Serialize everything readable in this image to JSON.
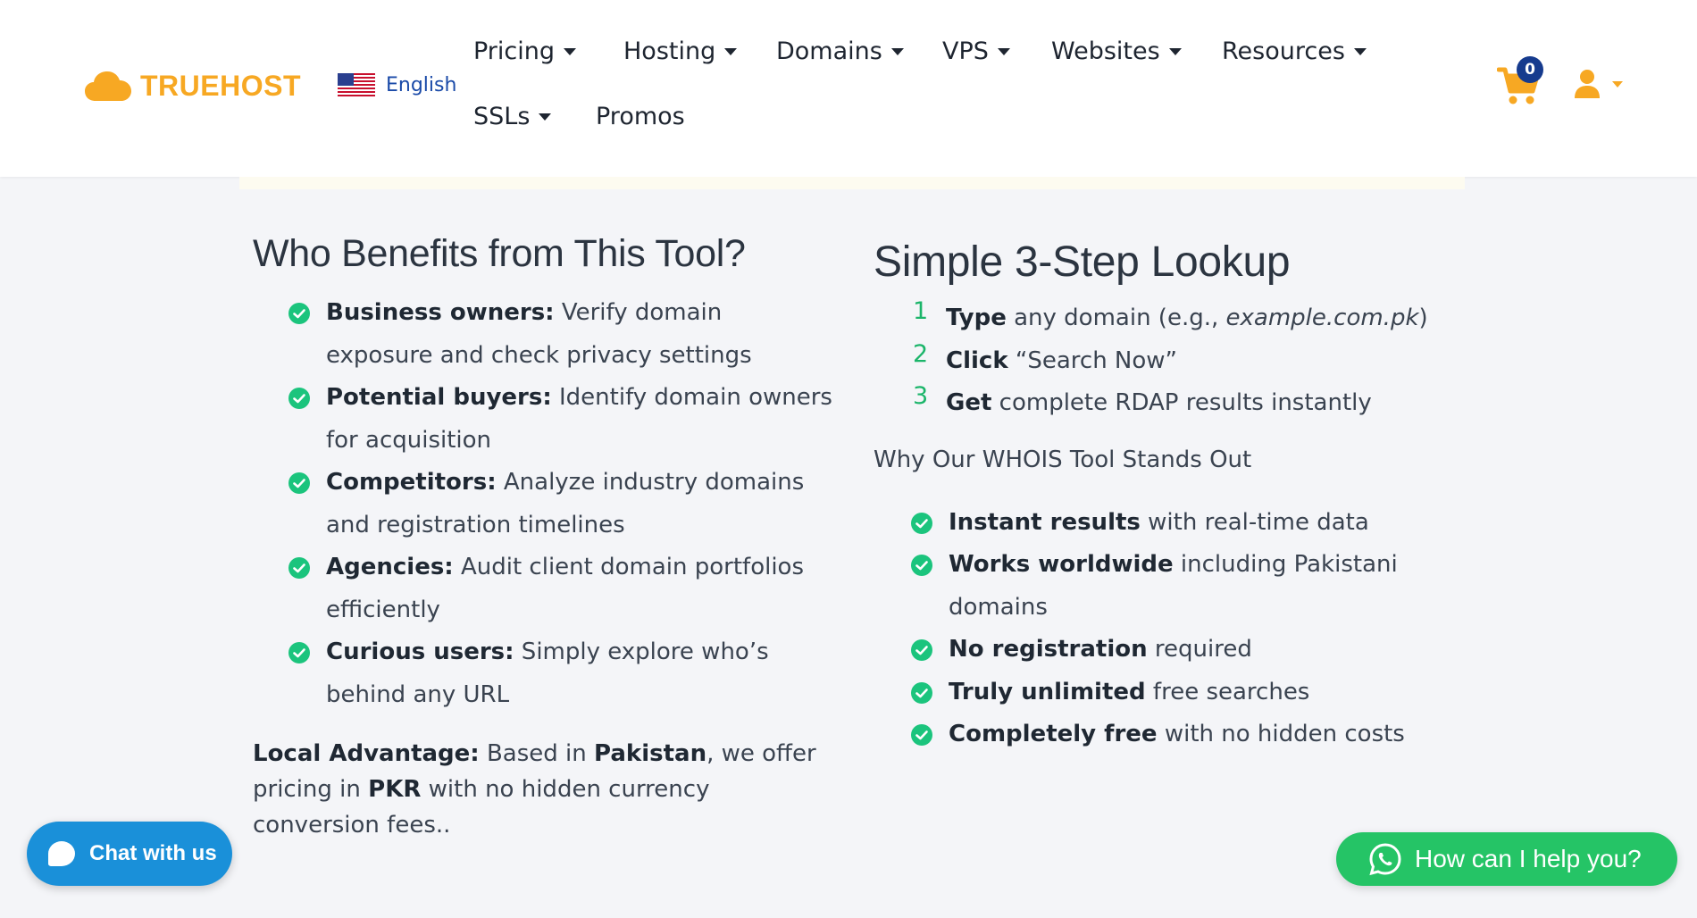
{
  "header": {
    "logo_text": "TRUEHOST",
    "language": "English",
    "nav": [
      {
        "label": "Pricing",
        "has_dropdown": true
      },
      {
        "label": "Hosting",
        "has_dropdown": true
      },
      {
        "label": "Domains",
        "has_dropdown": true
      },
      {
        "label": "VPS",
        "has_dropdown": true
      },
      {
        "label": "Websites",
        "has_dropdown": true
      },
      {
        "label": "Resources",
        "has_dropdown": true
      },
      {
        "label": "SSLs",
        "has_dropdown": true
      },
      {
        "label": "Promos",
        "has_dropdown": false
      }
    ],
    "cart_count": "0",
    "icons": {
      "cart": "cart-icon",
      "user": "user-icon",
      "logo": "cloud-logo-icon",
      "flag": "us-flag-icon"
    }
  },
  "left": {
    "title": "Who Benefits from This Tool?",
    "items": [
      {
        "bold": "Business owners:",
        "text": " Verify domain exposure and check privacy settings"
      },
      {
        "bold": "Potential buyers:",
        "text": " Identify domain owners for acquisition"
      },
      {
        "bold": "Competitors:",
        "text": " Analyze industry domains and registration timelines"
      },
      {
        "bold": "Agencies:",
        "text": " Audit client domain portfolios efficiently"
      },
      {
        "bold": "Curious users:",
        "text": " Simply explore who’s behind any URL"
      }
    ],
    "advantage": {
      "label": "Local Advantage:",
      "text1": " Based in ",
      "country": "Pakistan",
      "text2": ", we offer pricing in ",
      "currency": "PKR",
      "text3": " with no hidden currency conversion fees.."
    }
  },
  "right": {
    "title": "Simple 3-Step Lookup",
    "steps": [
      {
        "num": "1",
        "bold": "Type",
        "text": " any domain (e.g., ",
        "italic": "example.com.pk",
        "tail": ")"
      },
      {
        "num": "2",
        "bold": "Click",
        "text": " “Search Now”",
        "italic": "",
        "tail": ""
      },
      {
        "num": "3",
        "bold": "Get",
        "text": " complete RDAP results instantly",
        "italic": "",
        "tail": ""
      }
    ],
    "why_title": "Why Our WHOIS Tool Stands Out",
    "features": [
      {
        "bold": "Instant results",
        "text": " with real-time data"
      },
      {
        "bold": "Works worldwide",
        "text": " including Pakistani domains"
      },
      {
        "bold": "No registration",
        "text": " required"
      },
      {
        "bold": "Truly unlimited",
        "text": " free searches"
      },
      {
        "bold": "Completely free",
        "text": " with no hidden costs"
      }
    ]
  },
  "chat": {
    "label": "Chat with us"
  },
  "whatsapp": {
    "label": "How can I help you?"
  },
  "colors": {
    "brand": "#f7a823",
    "check": "#1bc47d",
    "chat": "#1a90d9",
    "whatsapp": "#25c466",
    "badge": "#163b8e"
  }
}
